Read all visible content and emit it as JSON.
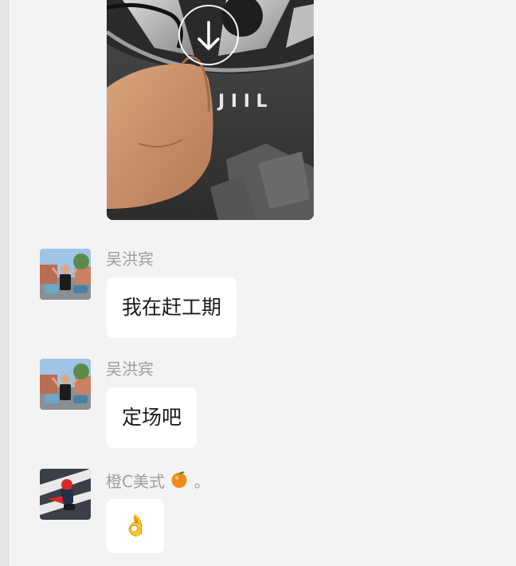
{
  "messages": [
    {
      "sender": "吴洪宾",
      "text": "我在赶工期"
    },
    {
      "sender": "吴洪宾",
      "text": "定场吧"
    },
    {
      "sender": "橙C美式",
      "sender_suffix": " 。",
      "text": "👌"
    }
  ],
  "photo_tire_text": "J I I L"
}
